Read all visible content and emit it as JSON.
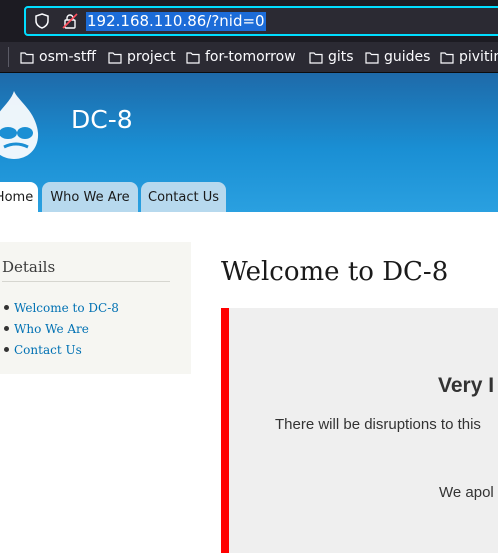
{
  "browser": {
    "url": "192.168.110.86/?nid=0",
    "bookmarks": [
      {
        "label": "osm-stff",
        "icon": "folder-icon"
      },
      {
        "label": "project",
        "icon": "folder-icon"
      },
      {
        "label": "for-tomorrow",
        "icon": "folder-icon"
      },
      {
        "label": "gits",
        "icon": "folder-icon"
      },
      {
        "label": "guides",
        "icon": "folder-icon"
      },
      {
        "label": "pivitin",
        "icon": "folder-icon"
      }
    ]
  },
  "site": {
    "name": "DC-8",
    "logo_icon": "drupal-logo-icon",
    "tabs": [
      {
        "label": "Home",
        "active": true
      },
      {
        "label": "Who We Are",
        "active": false
      },
      {
        "label": "Contact Us",
        "active": false
      }
    ]
  },
  "sidebar": {
    "title": "Details",
    "items": [
      "Welcome to DC-8",
      "Who We Are",
      "Contact Us"
    ]
  },
  "main": {
    "title": "Welcome to DC-8",
    "notice": {
      "heading": "Very I",
      "line1": "There will be disruptions to this",
      "line2": "We apol"
    }
  },
  "colors": {
    "header_blue": "#1a8fd4",
    "tab_bg": "#b7d9ee",
    "notice_border": "#ff0000",
    "link": "#0071b3",
    "url_highlight": "#1c6cd8"
  }
}
